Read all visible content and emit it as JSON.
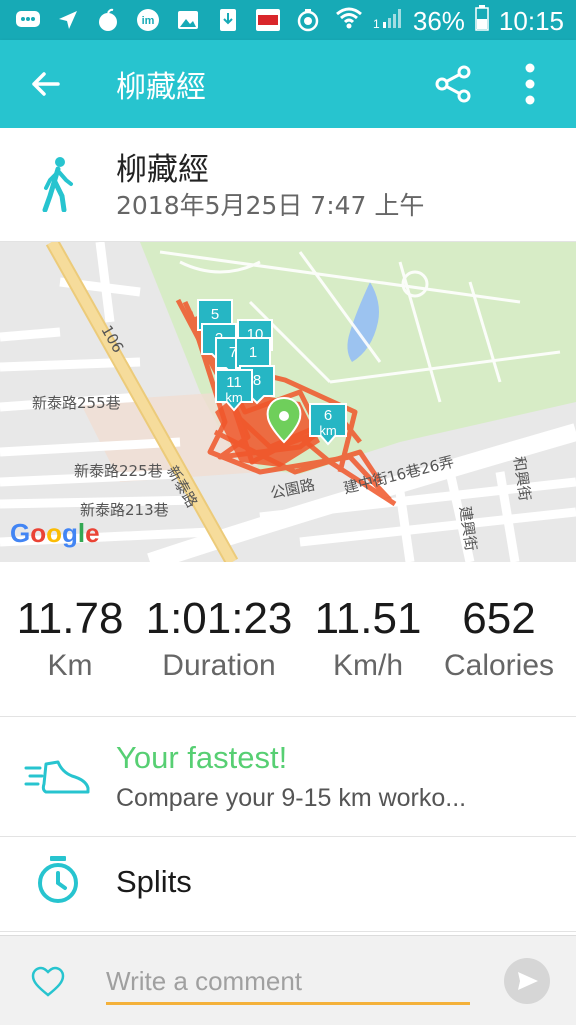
{
  "status_bar": {
    "battery": "36%",
    "time": "10:15",
    "notification_icons": [
      "message-icon",
      "navigation-icon",
      "fruit-app-icon",
      "im-app-icon",
      "image-icon",
      "download-icon",
      "news-app-icon",
      "camera-icon"
    ],
    "signal_label": "1"
  },
  "app_bar": {
    "title": "柳藏經",
    "back_icon": "back-arrow-icon",
    "share_icon": "share-icon",
    "more_icon": "more-vert-icon"
  },
  "activity": {
    "type_icon": "walking-icon",
    "title": "柳藏經",
    "date": "2018年5月25日 7:47 上午"
  },
  "map": {
    "streets": [
      "106",
      "新泰路255巷",
      "新泰路225巷",
      "新泰路213巷",
      "新泰路",
      "公園路",
      "建中街16巷26弄",
      "建興街",
      "和興街"
    ],
    "km_markers": [
      "5",
      "2",
      "10",
      "7",
      "1",
      "8",
      "11",
      "6",
      "km"
    ],
    "provider": "Google"
  },
  "stats": [
    {
      "value": "11.78",
      "label": "Km"
    },
    {
      "value": "1:01:23",
      "label": "Duration"
    },
    {
      "value": "11.51",
      "label": "Km/h"
    },
    {
      "value": "652",
      "label": "Calories"
    }
  ],
  "fastest": {
    "title": "Your fastest!",
    "subtitle": "Compare your 9-15 km worko..."
  },
  "splits": {
    "label": "Splits"
  },
  "comment": {
    "placeholder": "Write a comment"
  },
  "colors": {
    "status_bar": "#17aab6",
    "app_bar": "#27c4cf",
    "accent_green": "#57cf73",
    "route": "#f0562a",
    "marker": "#26b6c4",
    "comment_underline": "#f4b13a"
  }
}
